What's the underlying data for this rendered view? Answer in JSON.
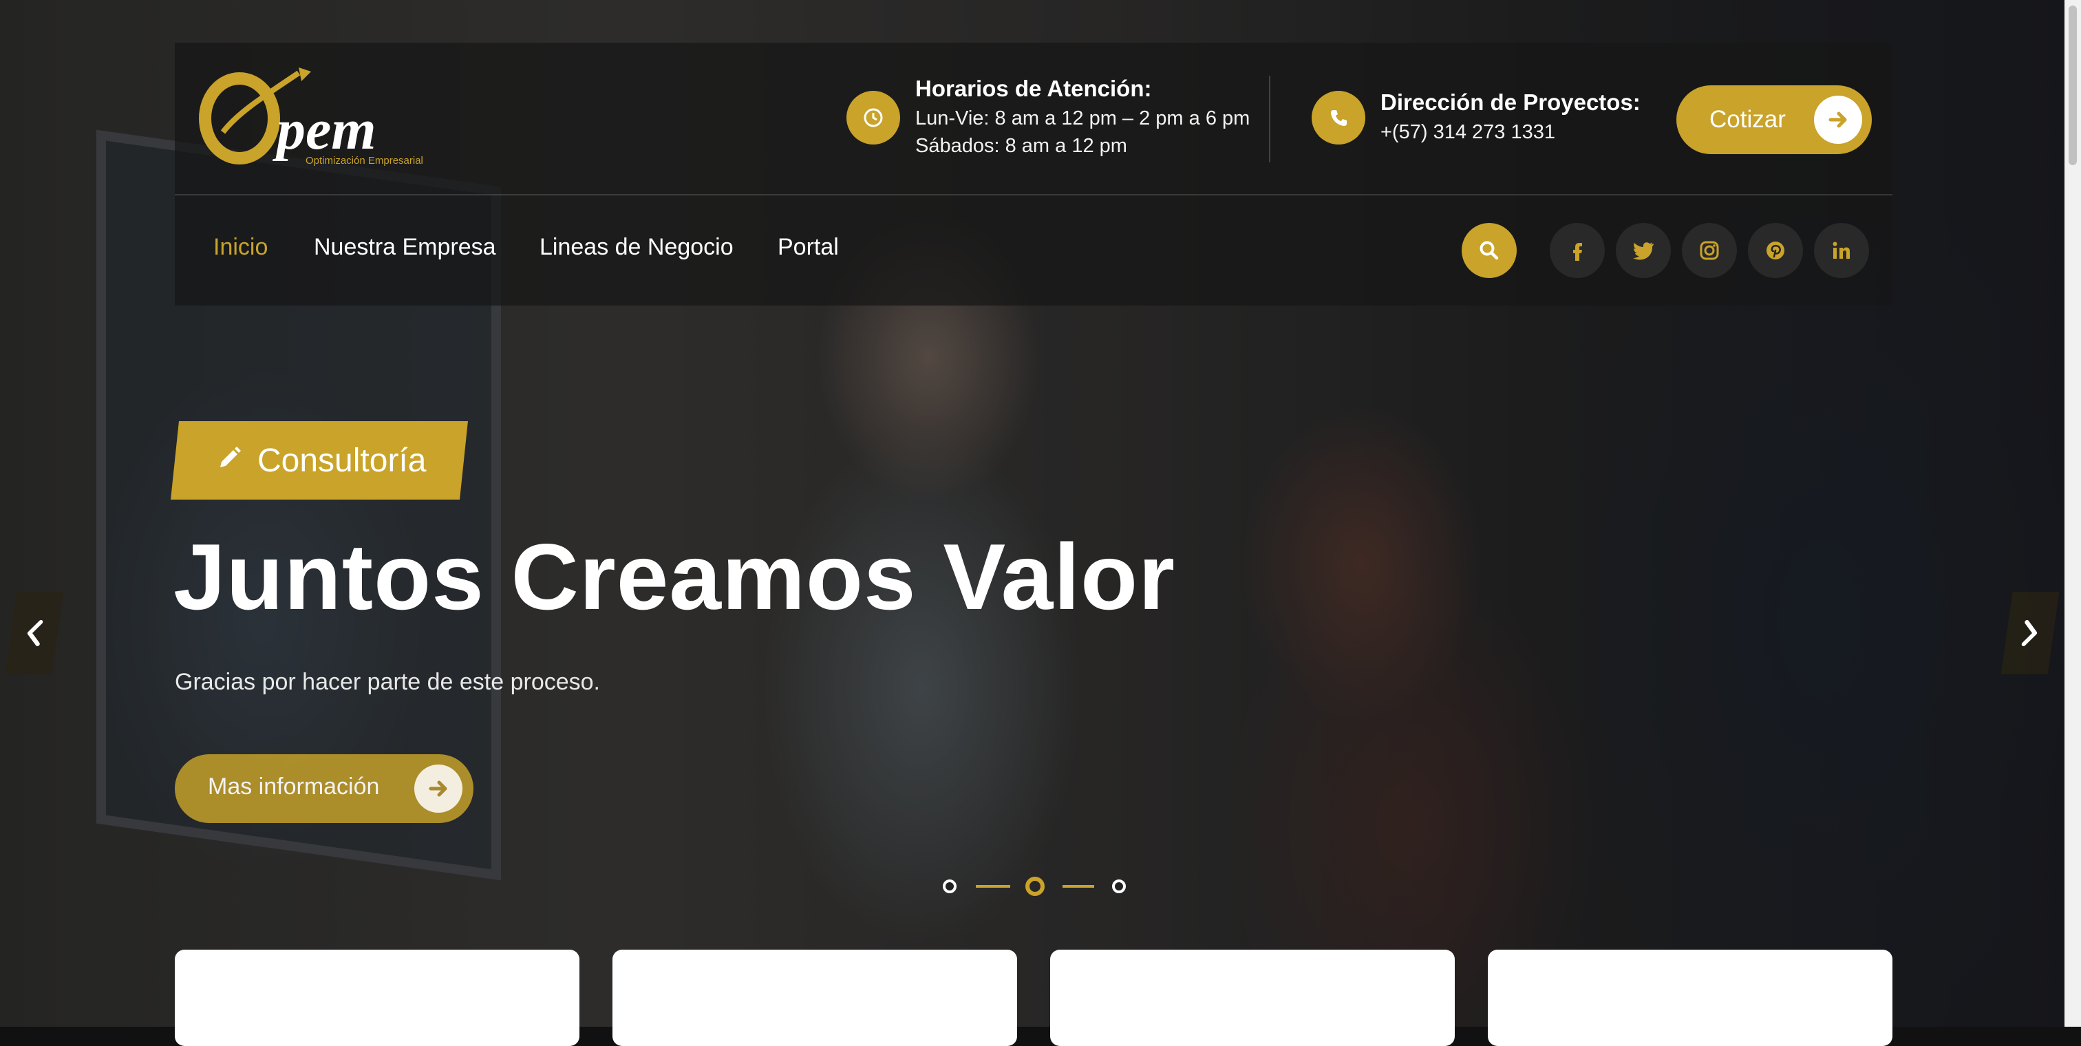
{
  "brand": {
    "logo_text": "pem",
    "logo_tagline": "Optimización Empresarial",
    "accent_color": "#c9a32a"
  },
  "header": {
    "hours": {
      "icon": "clock-icon",
      "title": "Horarios de Atención:",
      "line1": "Lun-Vie: 8 am a 12 pm – 2 pm a 6 pm",
      "line2": "Sábados: 8 am a 12 pm"
    },
    "contact": {
      "icon": "phone-icon",
      "title": "Dirección de Proyectos:",
      "phone": "+(57) 314 273 1331"
    },
    "cta_label": "Cotizar"
  },
  "nav": {
    "items": [
      {
        "label": "Inicio",
        "active": true
      },
      {
        "label": "Nuestra Empresa",
        "active": false
      },
      {
        "label": "Lineas de Negocio",
        "active": false
      },
      {
        "label": "Portal",
        "active": false
      }
    ],
    "search_icon": "search-icon",
    "social": [
      "facebook-icon",
      "twitter-icon",
      "instagram-icon",
      "pinterest-icon",
      "linkedin-icon"
    ]
  },
  "slide": {
    "tag_icon": "pencil-icon",
    "tag_label": "Consultoría",
    "headline": "Juntos Creamos Valor",
    "subtitle": "Gracias por hacer parte de este proceso.",
    "button_label": "Mas información",
    "active_index": 2,
    "total": 3
  }
}
